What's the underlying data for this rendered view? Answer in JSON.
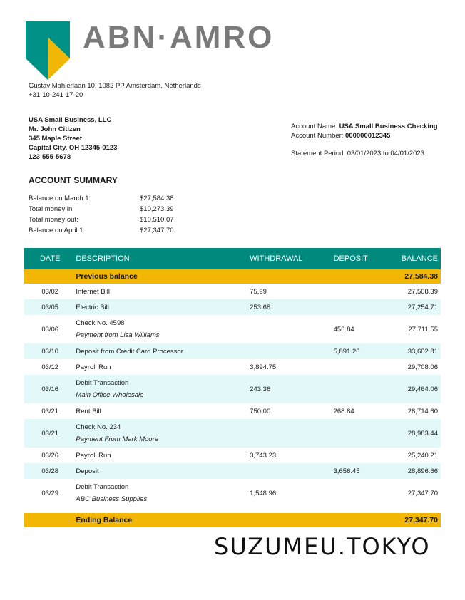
{
  "header": {
    "brand": "ABN·AMRO",
    "address_line1": "Gustav Mahlerlaan 10, 1082 PP Amsterdam, Netherlands",
    "address_line2": "+31-10-241-17-20"
  },
  "customer": {
    "line1": "USA Small Business, LLC",
    "line2": "Mr. John Citizen",
    "line3": "345 Maple Street",
    "line4": "Capital City, OH 12345-0123",
    "line5": "123-555-5678"
  },
  "account": {
    "name_label": "Account Name:",
    "name_value": "USA Small Business Checking",
    "number_label": "Account Number:",
    "number_value": "000000012345",
    "period_label": "Statement Period:",
    "period_value": "03/01/2023 to 04/01/2023"
  },
  "summary": {
    "title": "ACCOUNT SUMMARY",
    "rows": [
      {
        "label": "Balance on March 1:",
        "value": "$27,584.38"
      },
      {
        "label": "Total money in:",
        "value": "$10,273.39"
      },
      {
        "label": "Total money out:",
        "value": "$10,510.07"
      },
      {
        "label": "Balance on April 1:",
        "value": "$27,347.70"
      }
    ]
  },
  "table": {
    "headers": {
      "date": "DATE",
      "description": "DESCRIPTION",
      "withdrawal": "WITHDRAWAL",
      "deposit": "DEPOSIT",
      "balance": "BALANCE"
    },
    "previous": {
      "label": "Previous balance",
      "balance": "27,584.38"
    },
    "rows": [
      {
        "date": "03/02",
        "desc": "Internet Bill",
        "sub": "",
        "wd": "75.99",
        "dep": "",
        "bal": "27,508.39"
      },
      {
        "date": "03/05",
        "desc": "Electric Bill",
        "sub": "",
        "wd": "253.68",
        "dep": "",
        "bal": "27,254.71"
      },
      {
        "date": "03/06",
        "desc": "Check No. 4598",
        "sub": "Payment from Lisa Williams",
        "wd": "",
        "dep": "456.84",
        "bal": "27,711.55"
      },
      {
        "date": "03/10",
        "desc": "Deposit from Credit Card Processor",
        "sub": "",
        "wd": "",
        "dep": "5,891.26",
        "bal": "33,602.81"
      },
      {
        "date": "03/12",
        "desc": "Payroll Run",
        "sub": "",
        "wd": "3,894.75",
        "dep": "",
        "bal": "29,708.06"
      },
      {
        "date": "03/16",
        "desc": "Debit Transaction",
        "sub": "Main Office Wholesale",
        "wd": "243.36",
        "dep": "",
        "bal": "29,464.06"
      },
      {
        "date": "03/21",
        "desc": "Rent Bill",
        "sub": "",
        "wd": "750.00",
        "dep": "268.84",
        "bal": "28,714.60"
      },
      {
        "date": "03/21",
        "desc": "Check No. 234",
        "sub": "Payment From Mark Moore",
        "wd": "",
        "dep": "",
        "bal": "28,983.44"
      },
      {
        "date": "03/26",
        "desc": "Payroll Run",
        "sub": "",
        "wd": "3,743.23",
        "dep": "",
        "bal": "25,240.21"
      },
      {
        "date": "03/28",
        "desc": "Deposit",
        "sub": "",
        "wd": "",
        "dep": "3,656.45",
        "bal": "28,896.66"
      },
      {
        "date": "03/29",
        "desc": "Debit Transaction",
        "sub": "ABC Business Supplies",
        "wd": "1,548.96",
        "dep": "",
        "bal": "27,347.70"
      }
    ],
    "ending": {
      "label": "Ending Balance",
      "balance": "27,347.70"
    }
  },
  "watermark": "SUZUMEU.TOKYO",
  "colors": {
    "teal": "#008a7e",
    "gold": "#f2b705",
    "row_alt": "#e3f9f9",
    "brand_gray": "#7a7a7a"
  }
}
